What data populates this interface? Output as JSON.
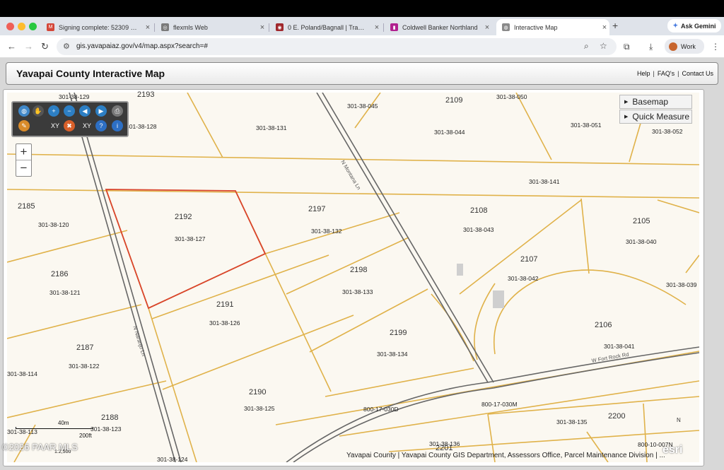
{
  "browser": {
    "tabs": [
      {
        "label": "Signing complete: 52309 N N",
        "fav_color": "#d44638",
        "fav_glyph": "M"
      },
      {
        "label": "flexmls Web",
        "fav_color": "#7a7a7a",
        "fav_glyph": "◎"
      },
      {
        "label": "0 E. Poland/Bagnall | Transact",
        "fav_color": "#a0282d",
        "fav_glyph": "◉"
      },
      {
        "label": "Coldwell Banker Northland",
        "fav_color": "#b1208f",
        "fav_glyph": "▮"
      },
      {
        "label": "Interactive Map",
        "fav_color": "#8a8a8a",
        "fav_glyph": "◍"
      }
    ],
    "new_tab": "+",
    "gemini_label": "Ask Gemini",
    "url": "gis.yavapaiaz.gov/v4/map.aspx?search=#",
    "profile_label": "Work"
  },
  "page": {
    "title": "Yavapai County Interactive Map",
    "links": [
      "Help",
      "FAQ's",
      "Contact Us"
    ],
    "link_separator": "|"
  },
  "map": {
    "panels": [
      "Basemap",
      "Quick Measure"
    ],
    "zoom_in": "+",
    "zoom_out": "−",
    "tool_labels": [
      "XY",
      "XY"
    ],
    "scale": {
      "metric": "40m",
      "imperial": "200ft",
      "ratio": "1:2,500"
    },
    "attribution": "Yavapai County | Yavapai County GIS Department, Assessors Office, Parcel Maintenance Division | ...",
    "watermark": "©2026 PAAR MLS",
    "esri": "esri",
    "north": "N",
    "parcels": [
      {
        "num": "",
        "apn": "301-38-129"
      },
      {
        "num": "2193",
        "apn": ""
      },
      {
        "num": "",
        "apn": "301-38-045"
      },
      {
        "num": "2109",
        "apn": "301-38-044"
      },
      {
        "num": "",
        "apn": "301-38-050"
      },
      {
        "num": "",
        "apn": "301-38-128"
      },
      {
        "num": "",
        "apn": "301-38-131"
      },
      {
        "num": "",
        "apn": "301-38-051"
      },
      {
        "num": "",
        "apn": "301-38-052"
      },
      {
        "num": "",
        "apn": "301-38-141"
      },
      {
        "num": "2185",
        "apn": "301-38-120"
      },
      {
        "num": "2192",
        "apn": "301-38-127"
      },
      {
        "num": "2197",
        "apn": "301-38-132"
      },
      {
        "num": "2108",
        "apn": "301-38-043"
      },
      {
        "num": "2105",
        "apn": "301-38-040"
      },
      {
        "num": "2186",
        "apn": "301-38-121"
      },
      {
        "num": "2198",
        "apn": "301-38-133"
      },
      {
        "num": "2107",
        "apn": "301-38-042"
      },
      {
        "num": "",
        "apn": "301-38-039"
      },
      {
        "num": "2191",
        "apn": "301-38-126"
      },
      {
        "num": "2106",
        "apn": "301-38-041"
      },
      {
        "num": "2187",
        "apn": "301-38-122"
      },
      {
        "num": "2199",
        "apn": "301-38-134"
      },
      {
        "num": "",
        "apn": "301-38-114"
      },
      {
        "num": "2190",
        "apn": "301-38-125"
      },
      {
        "num": "",
        "apn": "800-17-030D"
      },
      {
        "num": "",
        "apn": "800-17-030M"
      },
      {
        "num": "2188",
        "apn": "301-38-123"
      },
      {
        "num": "",
        "apn": "301-38-113"
      },
      {
        "num": "2200",
        "apn": "301-38-135"
      },
      {
        "num": "2201",
        "apn": "301-38-136"
      },
      {
        "num": "",
        "apn": "301-38-124"
      },
      {
        "num": "",
        "apn": "800-10-007N"
      }
    ],
    "roads": [
      "N Montana Ln",
      "N Naranjo Ln",
      "W Fort Rock Rd"
    ]
  },
  "colors": {
    "parcel_line": "#e0b24a",
    "selected_parcel": "#d9452c",
    "road": "#666666",
    "map_bg": "#fbf8f1"
  }
}
